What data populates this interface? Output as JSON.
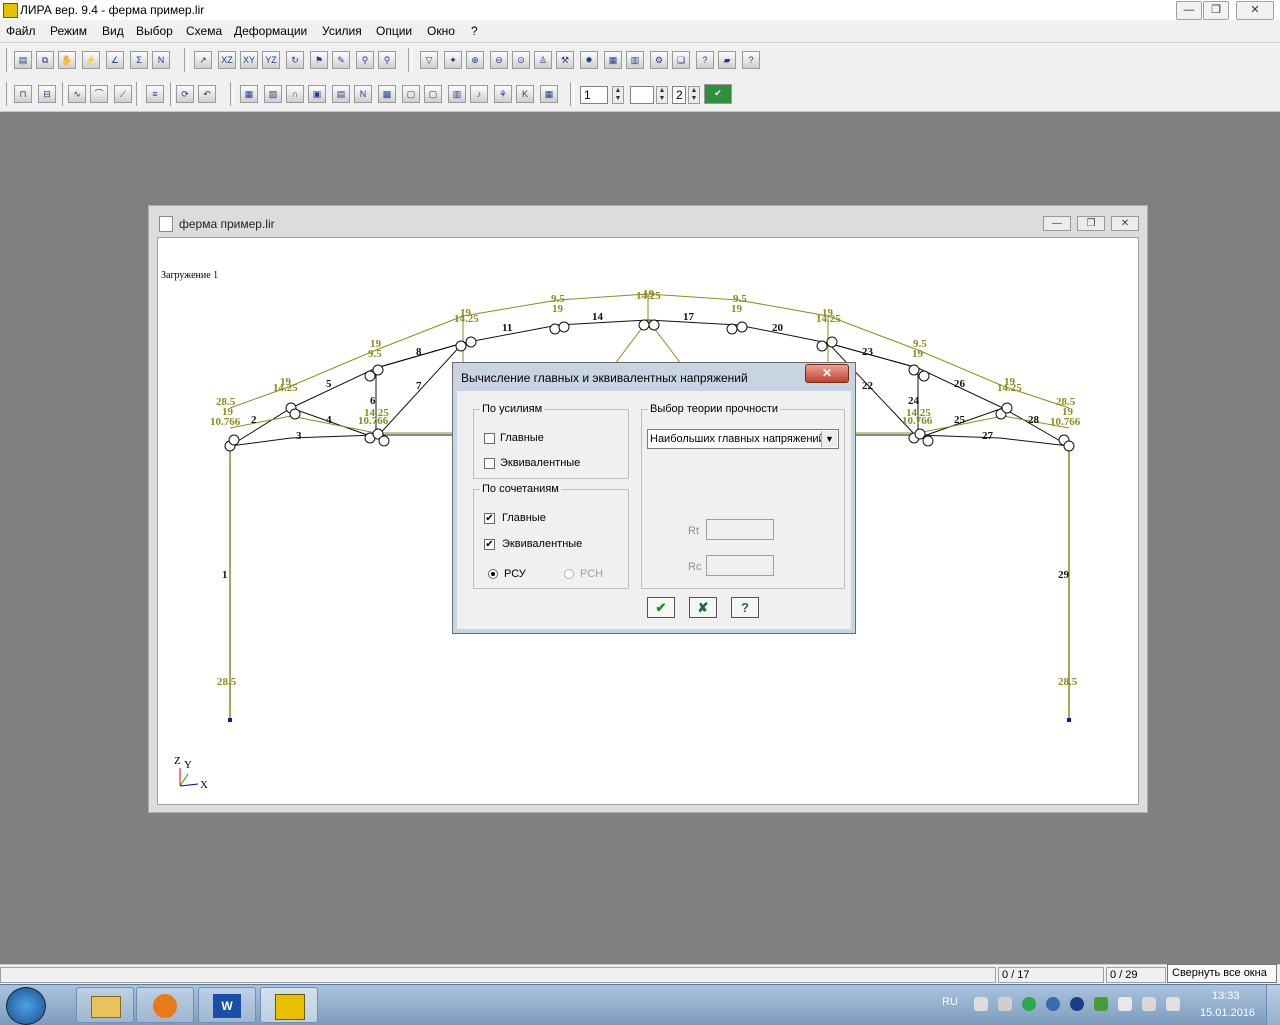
{
  "window": {
    "title": "ЛИРА  вер. 9.4 - ферма пример.lir",
    "min": "—",
    "max": "❐",
    "close": "✕"
  },
  "menu": [
    "Файл",
    "Режим",
    "Вид",
    "Выбор",
    "Схема",
    "Деформации",
    "Усилия",
    "Опции",
    "Окно",
    "?"
  ],
  "toolbar": {
    "spin1_value": "1",
    "spin2_value": "",
    "spin3_value": "2"
  },
  "document": {
    "title": "ферма пример.lir",
    "load_label": "Загружение  1",
    "axes": {
      "z": "Z",
      "y": "Y",
      "x": "X"
    },
    "top_values": [
      "28.5",
      "19",
      "10.766",
      "19",
      "14.25",
      "19",
      "9.5",
      "14.25",
      "19",
      "9.5",
      "19",
      "14.25",
      "19",
      "9.5",
      "19",
      "14.25",
      "19",
      "9.5",
      "19",
      "14.25",
      "19",
      "28.5",
      "19",
      "10.766",
      "14.25",
      "10.766",
      "14.25",
      "10.766"
    ],
    "bottom_values": [
      "28.5",
      "28.5"
    ],
    "element_numbers": [
      "1",
      "2",
      "3",
      "4",
      "5",
      "6",
      "7",
      "8",
      "11",
      "14",
      "17",
      "20",
      "22",
      "23",
      "24",
      "25",
      "26",
      "27",
      "28",
      "29"
    ]
  },
  "dialog": {
    "title": "Вычисление главных и эквивалентных напряжений",
    "close": "✕",
    "group_forces": {
      "title": "По усилиям",
      "main": "Главные",
      "equiv": "Эквивалентные",
      "main_checked": false,
      "equiv_checked": false
    },
    "group_combos": {
      "title": "По сочетаниям",
      "main": "Главные",
      "equiv": "Эквивалентные",
      "main_checked": true,
      "equiv_checked": true,
      "radio1": "РСУ",
      "radio2": "РСН",
      "selected": "РСУ"
    },
    "group_theory": {
      "title": "Выбор теории прочности",
      "selected": "Наибольших главных напряжений",
      "rt_label": "Rt",
      "rc_label": "Rc",
      "rt_value": "",
      "rc_value": ""
    },
    "ok": "✔",
    "cancel": "✘",
    "help": "?"
  },
  "status": {
    "field1": "",
    "field2": "0 / 17",
    "field3": "0 / 29"
  },
  "taskbar": {
    "tooltip": "Свернуть все окна",
    "lang": "RU",
    "time": "13:33",
    "date": "15.01.2016"
  },
  "colors": {
    "accent_olive": "#8b8b1e",
    "truss_black": "#111111",
    "support_blue": "#1010c8"
  }
}
